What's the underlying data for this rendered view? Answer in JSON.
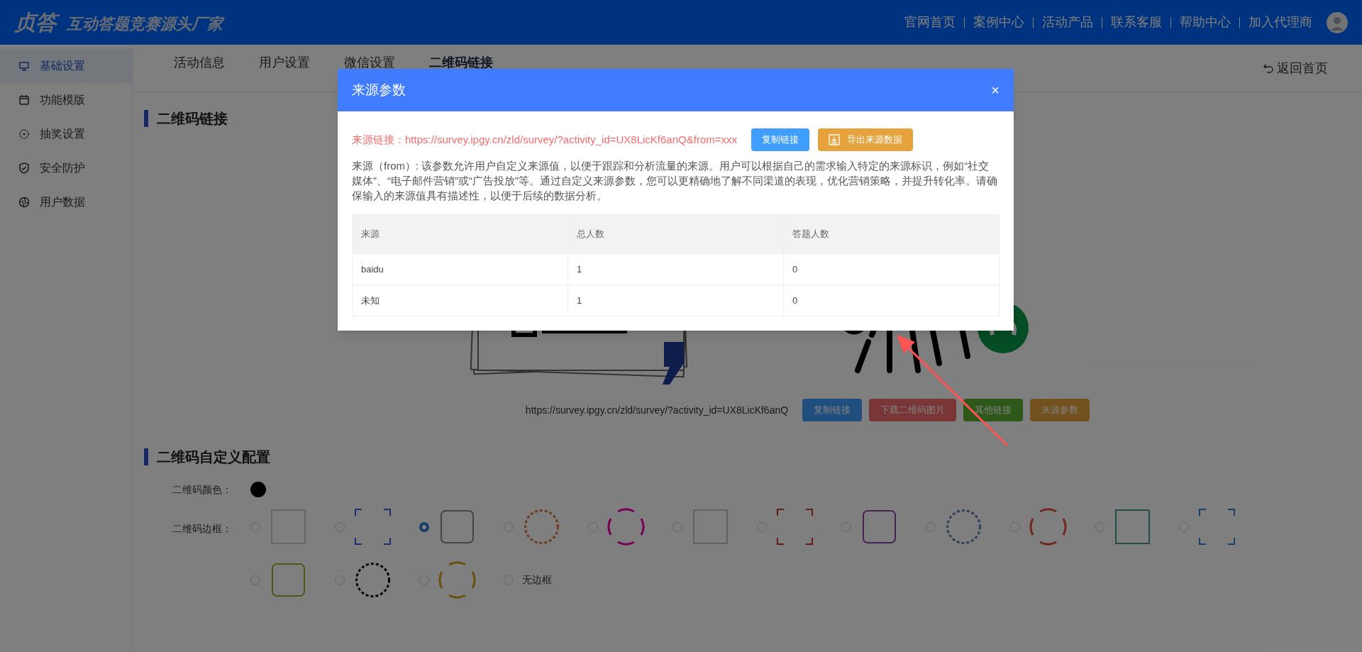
{
  "header": {
    "logo": "贞答",
    "slogan": "互动答题竞赛源头厂家",
    "nav": [
      "官网首页",
      "案例中心",
      "活动产品",
      "联系客服",
      "帮助中心",
      "加入代理商"
    ]
  },
  "sidebar": {
    "items": [
      {
        "label": "基础设置",
        "selected": true
      },
      {
        "label": "功能模版",
        "selected": false
      },
      {
        "label": "抽奖设置",
        "selected": false
      },
      {
        "label": "安全防护",
        "selected": false
      },
      {
        "label": "用户数据",
        "selected": false
      }
    ]
  },
  "tabs": [
    {
      "label": "活动信息",
      "selected": false
    },
    {
      "label": "用户设置",
      "selected": false
    },
    {
      "label": "微信设置",
      "selected": false
    },
    {
      "label": "二维码链接",
      "selected": true
    }
  ],
  "back_link": "返回首页",
  "qr_section": {
    "title": "二维码链接",
    "url": "https://survey.ipgy.cn/zld/survey/?activity_id=UX8LicKf6anQ",
    "buttons": [
      {
        "label": "复制链接"
      },
      {
        "label": "下载二维码图片"
      },
      {
        "label": "其他链接"
      },
      {
        "label": "来源参数"
      }
    ]
  },
  "custom_section": {
    "title": "二维码自定义配置",
    "color_label": "二维码颜色：",
    "color": "#000000",
    "border_label": "二维码边框：",
    "borders": [
      {
        "kind": "frame",
        "selected": false
      },
      {
        "kind": "frame",
        "selected": false
      },
      {
        "kind": "frame",
        "selected": true
      },
      {
        "kind": "frame",
        "selected": false
      },
      {
        "kind": "frame",
        "selected": false
      },
      {
        "kind": "frame",
        "selected": false
      },
      {
        "kind": "frame",
        "selected": false
      },
      {
        "kind": "frame",
        "selected": false
      },
      {
        "kind": "frame",
        "selected": false
      },
      {
        "kind": "frame",
        "selected": false
      },
      {
        "kind": "frame",
        "selected": false
      },
      {
        "kind": "frame",
        "selected": false
      },
      {
        "kind": "frame",
        "selected": false
      },
      {
        "kind": "frame",
        "selected": false
      },
      {
        "kind": "frame",
        "selected": false
      },
      {
        "kind": "text",
        "label": "无边框",
        "selected": false
      }
    ]
  },
  "modal": {
    "title": "来源参数",
    "close": "×",
    "link_label": "来源链接：",
    "link": "https://survey.ipgy.cn/zld/survey/?activity_id=UX8LicKf6anQ&from=xxx",
    "buttons": [
      {
        "label": "复制链接",
        "kind": "copy"
      },
      {
        "label": "导出来源数据",
        "kind": "export"
      }
    ],
    "description": "来源（from）: 该参数允许用户自定义来源值，以便于跟踪和分析流量的来源。用户可以根据自己的需求输入特定的来源标识，例如“社交媒体”、“电子邮件营销”或“广告投放”等。通过自定义来源参数，您可以更精确地了解不同渠道的表现，优化营销策略，并提升转化率。请确保输入的来源值具有描述性，以便于后续的数据分析。",
    "table": {
      "columns": [
        "来源",
        "总人数",
        "答题人数"
      ],
      "rows": [
        [
          "baidu",
          "1",
          "0"
        ],
        [
          "未知",
          "1",
          "0"
        ]
      ]
    }
  }
}
